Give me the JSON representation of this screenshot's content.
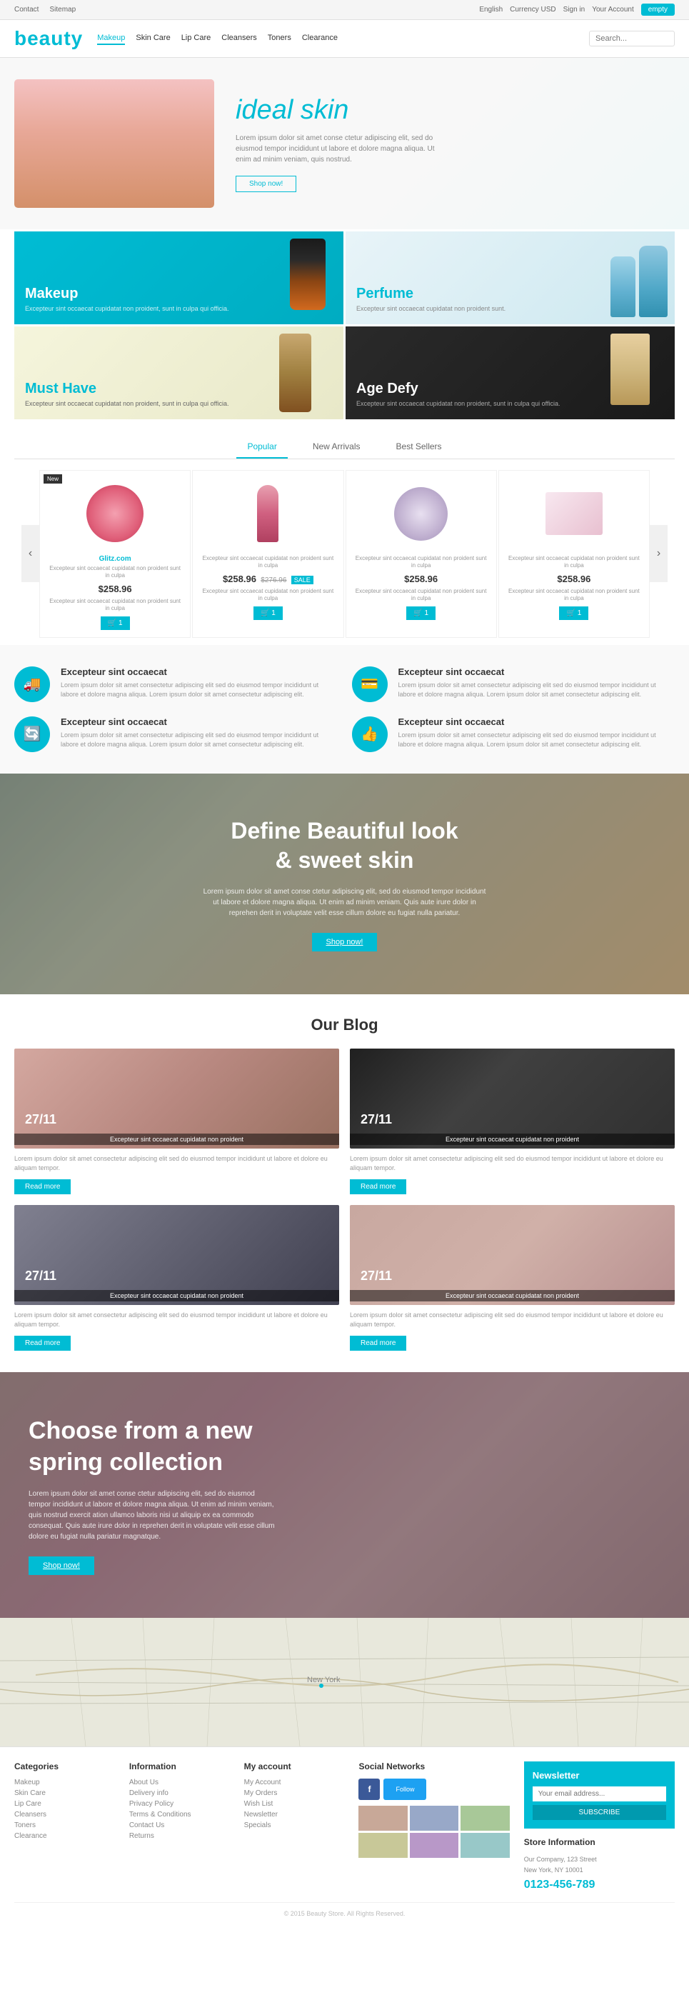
{
  "topbar": {
    "contact_label": "Contact",
    "sitemap_label": "Sitemap",
    "language": "English",
    "currency": "Currency USD",
    "signin_label": "Sign in",
    "account_label": "Your Account",
    "cart_label": "empty"
  },
  "header": {
    "logo": "beauty",
    "nav": [
      {
        "label": "Makeup",
        "active": true
      },
      {
        "label": "Skin Care"
      },
      {
        "label": "Lip Care"
      },
      {
        "label": "Cleansers"
      },
      {
        "label": "Toners"
      },
      {
        "label": "Clearance"
      }
    ],
    "search_placeholder": "Search..."
  },
  "hero": {
    "title": "ideal skin",
    "text": "Lorem ipsum dolor sit amet conse ctetur adipiscing elit, sed do eiusmod tempor incididunt ut labore et dolore magna aliqua. Ut enim ad minim veniam, quis nostrud.",
    "cta": "Shop now!"
  },
  "promo": [
    {
      "title": "Makeup",
      "style": "makeup",
      "text": "Excepteur sint occaecat cupidatat non proident, sunt in culpa qui officia."
    },
    {
      "title": "Perfume",
      "style": "perfume",
      "text": "Excepteur sint occaecat cupidatat non proident sunt."
    },
    {
      "title": "Must Have",
      "style": "musthave",
      "text": "Excepteur sint occaecat cupidatat non proident, sunt in culpa qui officia."
    },
    {
      "title": "Age Defy",
      "style": "agedefy",
      "text": "Excepteur sint occaecat cupidatat non proident, sunt in culpa qui officia."
    }
  ],
  "tabs": {
    "items": [
      "Popular",
      "New Arrivals",
      "Best Sellers"
    ],
    "active": "Popular"
  },
  "products": [
    {
      "name": "Glitz.com",
      "price": "$258.96",
      "old_price": "",
      "badge": "New",
      "desc": "Excepteur sint occaecat cupidatat non proident sunt in culpa",
      "type": "compact"
    },
    {
      "name": "",
      "price": "$258.96",
      "old_price": "$276.96",
      "badge": "",
      "desc": "Excepteur sint occaecat cupidatat non proident sunt in culpa",
      "type": "lipstick"
    },
    {
      "name": "",
      "price": "$258.96",
      "old_price": "",
      "badge": "",
      "desc": "Excepteur sint occaecat cupidatat non proident sunt in culpa",
      "type": "ring"
    },
    {
      "name": "",
      "price": "$258.96",
      "old_price": "",
      "badge": "",
      "desc": "Excepteur sint occaecat cupidatat non proident sunt in culpa",
      "type": "box"
    }
  ],
  "features": [
    {
      "icon": "🚚",
      "title": "Excepteur sint occaecat",
      "text": "Lorem ipsum dolor sit amet conse ctetur adipiscing elit, sed do eiusmod tempor incididunt ut labore et dolore magna aliqua."
    },
    {
      "icon": "💳",
      "title": "Excepteur sint occaecat",
      "text": "Lorem ipsum dolor sit amet conse ctetur adipiscing elit, sed do eiusmod tempor incididunt ut labore et dolore magna aliqua."
    },
    {
      "icon": "🔄",
      "title": "Excepteur sint occaecat",
      "text": "Lorem ipsum dolor sit amet conse ctetur adipiscing elit, sed do eiusmod tempor incididunt ut labore et dolore magna aliqua."
    },
    {
      "icon": "👍",
      "title": "Excepteur sint occaecat",
      "text": "Lorem ipsum dolor sit amet conse ctetur adipiscing elit, sed do eiusmod tempor incididunt ut labore et dolore magna aliqua."
    }
  ],
  "banner": {
    "title": "Define Beautiful look\n& sweet skin",
    "text": "Lorem ipsum dolor sit amet conse ctetur adipiscing elit, sed do eiusmod tempor incididunt ut labore et dolore magna aliqua. Ut enim ad minim veniam. Quis aute irure dolor in reprehen derit in voluptate velit esse cillum dolore eu fugiat nulla pariatur.",
    "cta": "Shop now!"
  },
  "blog": {
    "section_title": "Our Blog",
    "posts": [
      {
        "date": "27/11",
        "caption": "Excepteur sint occaecat cupidatat non proident",
        "text": "Lorem ipsum dolor sit amet consectetur adipiscing elit sed do eiusmod tempor incididunt ut labore et dolore eu aliquam tempor.",
        "style": "woman"
      },
      {
        "date": "27/11",
        "caption": "Excepteur sint occaecat cupidatat non proident",
        "text": "Lorem ipsum dolor sit amet consectetur adipiscing elit sed do eiusmod tempor incididunt ut labore et dolore eu aliquam tempor.",
        "style": "woman2"
      },
      {
        "date": "27/11",
        "caption": "Excepteur sint occaecat cupidatat non proident",
        "text": "Lorem ipsum dolor sit amet consectetur adipiscing elit sed do eiusmod tempor incididunt ut labore et dolore eu aliquam tempor.",
        "style": "woman3"
      },
      {
        "date": "27/11",
        "caption": "Excepteur sint occaecat cupidatat non proident",
        "text": "Lorem ipsum dolor sit amet consectetur adipiscing elit sed do eiusmod tempor incididunt ut labore et dolore eu aliquam tempor.",
        "style": "woman4"
      }
    ],
    "read_more": "Read more"
  },
  "spring": {
    "title": "Choose from a new spring collection",
    "text": "Lorem ipsum dolor sit amet conse ctetur adipiscing elit, sed do eiusmod tempor incididunt ut labore et dolore magna aliqua. Ut enim ad minim veniam, quis nostrud exercit ation ullamco laboris nisi ut aliquip ex ea commodo consequat. Quis aute irure dolor in reprehen derit in voluptate velit esse cillum dolore eu fugiat nulla pariatur magnatque.",
    "cta": "Shop now!"
  },
  "footer": {
    "categories_title": "Categories",
    "categories": [
      "Makeup",
      "Skin Care",
      "Lip Care",
      "Cleansers",
      "Toners",
      "Clearance"
    ],
    "information_title": "Information",
    "information": [
      "About Us",
      "Delivery info",
      "Privacy Policy",
      "Terms & Conditions",
      "Contact Us",
      "Returns"
    ],
    "my_account_title": "My account",
    "my_account": [
      "My Account",
      "My Orders",
      "Wish List",
      "Newsletter",
      "Specials"
    ],
    "social_title": "Social Networks",
    "newsletter_title": "Newsletter",
    "newsletter_placeholder": "Your email address...",
    "newsletter_btn": "SUBSCRIBE",
    "store_info_title": "Store Information",
    "store_address": "Our Company, 123 Street\nNew York, NY 10001",
    "phone": "0123-456-789",
    "copyright": "© 2015 Beauty Store. All Rights Reserved."
  }
}
